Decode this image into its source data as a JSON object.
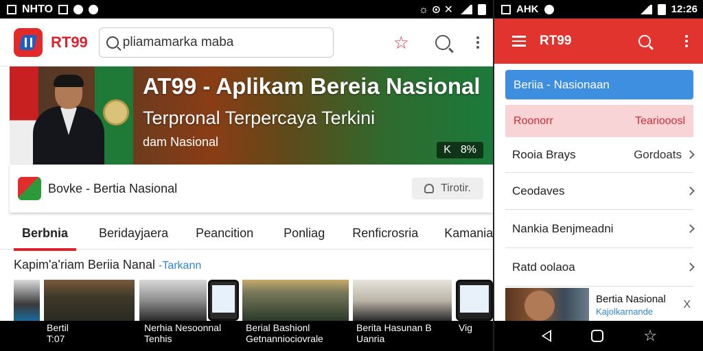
{
  "left_device": {
    "statusbar": {
      "left_text": "NHTO",
      "right_glyphs": "☼ ⊙ ✕"
    },
    "appbar": {
      "brand": "RT99",
      "search_value": "pliamamarka maba"
    },
    "banner": {
      "title": "AT99 - Aplikam Bereia Nasional",
      "subtitle": "Terpronal Terpercaya Terkini",
      "small": "dam Nasional",
      "chip_left": "K",
      "chip_right": "8%"
    },
    "card": {
      "title": "Bovke - Bertia Nasional",
      "button": "Tirotir."
    },
    "tabs": [
      {
        "label": "Berbnia",
        "active": true
      },
      {
        "label": "Beridayjaera",
        "active": false
      },
      {
        "label": "Peancition",
        "active": false
      },
      {
        "label": "Ponliag",
        "active": false
      },
      {
        "label": "Renficrosria",
        "active": false
      },
      {
        "label": "Kamanian",
        "active": false
      }
    ],
    "section": {
      "title": "Kapim'a'riam Beriia Nanal",
      "accent": "-Tarkann"
    },
    "bottom_labels": [
      {
        "l1": "Bertil",
        "l2": "T:07"
      },
      {
        "l1": "Nerhia Nesoonnal",
        "l2": "Tenhis"
      },
      {
        "l1": "Berial Bashionl",
        "l2": "Getnanniociovrale"
      },
      {
        "l1": "Berita Hasunan B",
        "l2": "Uanria"
      },
      {
        "l1": "Vig",
        "l2": ""
      }
    ]
  },
  "right_device": {
    "statusbar": {
      "left_text": "AHK",
      "time": "12:26"
    },
    "appbar": {
      "brand": "RT99"
    },
    "pill": "Beriia - Nasionaan",
    "highlight": {
      "left": "Roonorr",
      "right": "Teariooosl"
    },
    "rows": [
      {
        "left": "Rooia Brays",
        "right": "Gordoats"
      },
      {
        "left": "Ceodaves",
        "right": ""
      },
      {
        "left": "Nankia Benjmeadni",
        "right": ""
      },
      {
        "left": "Ratd oolaoa",
        "right": ""
      }
    ],
    "card": {
      "title": "Bertia Nasional",
      "subtitle": "Kajolkarnande",
      "close": "X"
    }
  },
  "colors": {
    "brand_red": "#e1342f",
    "accent_blue": "#3f8fe0",
    "tab_underline": "#d9232d"
  }
}
